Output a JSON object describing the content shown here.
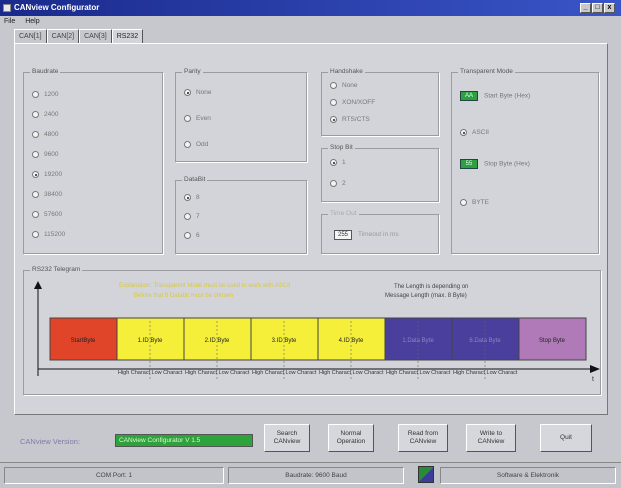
{
  "window": {
    "title": "CANview Configurator",
    "buttons": [
      "_",
      "□",
      "x"
    ]
  },
  "menu": [
    "File",
    "Help"
  ],
  "tabs": [
    "CAN[1]",
    "CAN[2]",
    "CAN[3]",
    "RS232"
  ],
  "groups": {
    "baudrate": {
      "title": "Baudrate",
      "options": [
        "1200",
        "2400",
        "4800",
        "9600",
        "19200",
        "38400",
        "57600",
        "115200"
      ],
      "selected": "19200"
    },
    "parity": {
      "title": "Parity",
      "options": [
        "None",
        "Even",
        "Odd"
      ],
      "selected": "None"
    },
    "databit": {
      "title": "DataBit",
      "options": [
        "8",
        "7",
        "6"
      ],
      "selected": "8"
    },
    "handshake": {
      "title": "Handshake",
      "options": [
        "None",
        "XON/XOFF",
        "RTS/CTS"
      ],
      "selected": "RTS/CTS"
    },
    "stopbit": {
      "title": "Stop Bit",
      "options": [
        "1",
        "2"
      ],
      "selected": "1"
    },
    "timeout": {
      "title": "Time Out",
      "value": "255",
      "label": "Timeout in ms"
    },
    "transparent": {
      "title": "Transparent Mode",
      "start_value": "AA",
      "start_label": "Start Byte (Hex)",
      "ascii": "ASCII",
      "stop_value": "55",
      "stop_label": "Stop Byte (Hex)",
      "byte": "BYTE",
      "selected": "ASCII"
    }
  },
  "telegram": {
    "title": "RS232 Telegram",
    "note_left_1": "Explanation: Transparent Mode must be used to work with ASCII",
    "note_left_2": "Before that 8 Databit must be chosen",
    "note_right_1": "The Length is depending on",
    "note_right_2": "Message Length (max. 8 Byte)",
    "blocks": [
      "StartByte",
      "1.ID Byte",
      "2.ID Byte",
      "3.ID Byte",
      "4.ID Byte",
      "1.Data Byte",
      "8.Data Byte",
      "Stop Byte"
    ],
    "nibbles": [
      "High Charact",
      "Low Charact"
    ],
    "axis_label": "t"
  },
  "footer": {
    "version_label": "CANview Version:",
    "version_value": "CANview Configurator V 1.5",
    "buttons": [
      "Search CANview",
      "Normal Operation",
      "Read from CANview",
      "Write to CANview",
      "Quit"
    ]
  },
  "status": {
    "port": "COM Port: 1",
    "baud": "Baudrate: 9600 Baud",
    "company": "Software & Elektronik"
  },
  "colors": {
    "start": "#e0452a",
    "id": "#f5ef3a",
    "data": "#4a3f9c",
    "stop": "#b07ab8",
    "green": "#2fa33b",
    "title": "#1a2a8c"
  }
}
